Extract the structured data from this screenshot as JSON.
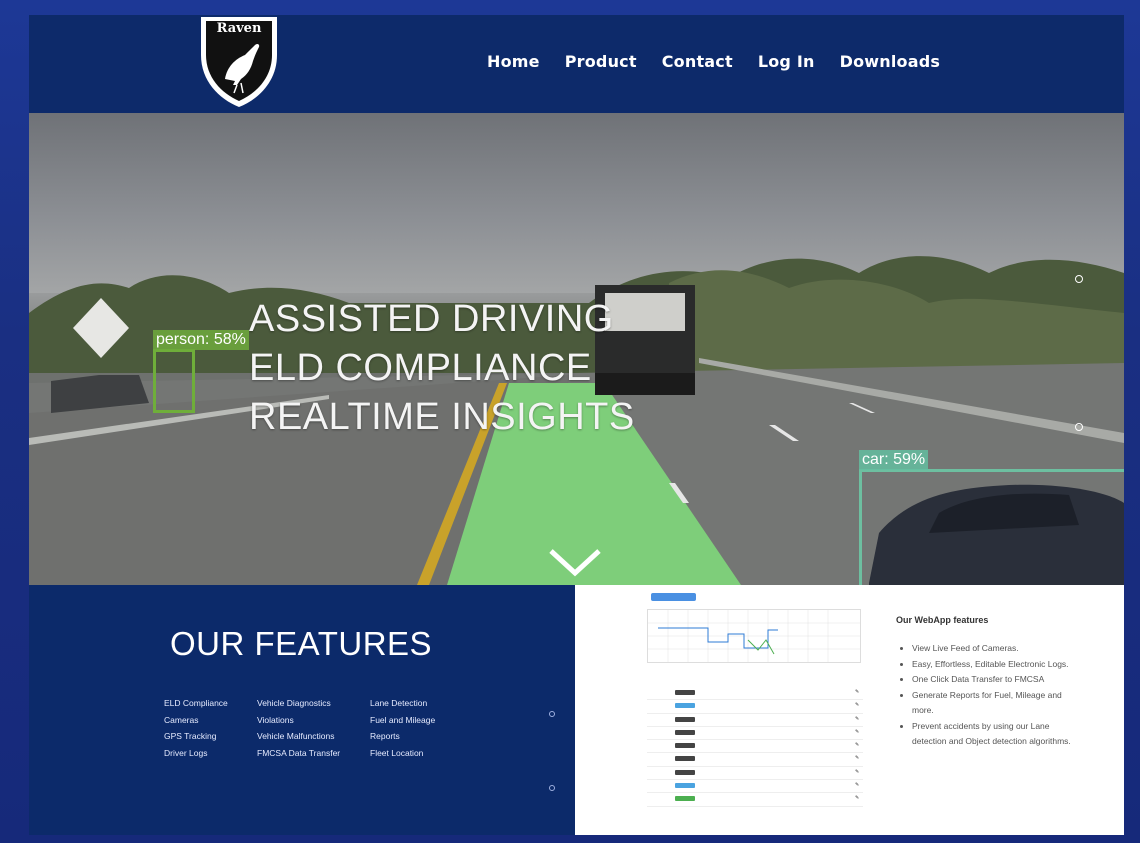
{
  "nav": {
    "logo_text": "Raven",
    "items": [
      "Home",
      "Product",
      "Contact",
      "Log In",
      "Downloads"
    ]
  },
  "hero": {
    "lines": [
      "ASSISTED DRIVING",
      "ELD COMPLIANCE",
      "REALTIME INSIGHTS"
    ],
    "detections": {
      "person": "person: 58%",
      "car": "car: 59%"
    },
    "scroll_icon": "chevron-down-icon"
  },
  "features": {
    "title": "OUR FEATURES",
    "col1": [
      "ELD Compliance",
      "Cameras",
      "GPS Tracking",
      "Driver Logs"
    ],
    "col2": [
      "Vehicle Diagnostics",
      "Violations",
      "Vehicle Malfunctions",
      "FMCSA Data Transfer"
    ],
    "col3": [
      "Lane Detection",
      "Fuel and Mileage",
      "Reports",
      "Fleet Location"
    ]
  },
  "webapp": {
    "title": "Our WebApp features",
    "items": [
      "View Live  Feed of Cameras.",
      "Easy, Effortless, Editable Electronic Logs.",
      "One Click Data Transfer to FMCSA",
      "Generate Reports for Fuel, Mileage and more.",
      "Prevent accidents by using our Lane detection and Object detection algorithms."
    ]
  },
  "colors": {
    "nav_bg": "#0d2a6a",
    "lane_overlay": "#7ed37a",
    "person_box": "#6fae3a",
    "car_box": "#6dbfa0"
  }
}
